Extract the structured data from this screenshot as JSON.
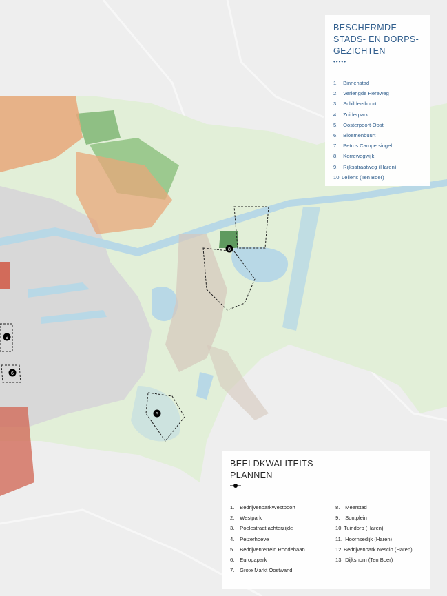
{
  "panels": {
    "stads": {
      "title_lines": [
        "BESCHERMDE",
        "STADS- EN DORPS-",
        "GEZICHTEN"
      ],
      "items": [
        {
          "num": "1.",
          "label": "Binnenstad"
        },
        {
          "num": "2.",
          "label": "Verlengde Hereweg"
        },
        {
          "num": "3.",
          "label": "Schildersbuurt"
        },
        {
          "num": "4.",
          "label": "Zuiderpark"
        },
        {
          "num": "5.",
          "label": "Oosterpoort-Oost"
        },
        {
          "num": "6.",
          "label": "Bloemenbuurt"
        },
        {
          "num": "7.",
          "label": "Petrus Campersingel"
        },
        {
          "num": "8.",
          "label": "Korrewegwijk"
        },
        {
          "num": "9.",
          "label": "Rijksstraatweg (Haren)"
        },
        {
          "num": "10.",
          "label": "Lellens (Ten Boer)"
        }
      ]
    },
    "plannen": {
      "title_lines": [
        "BEELDKWALITEITS-",
        "PLANNEN"
      ],
      "items_left": [
        {
          "num": "1.",
          "label": "BedrijvenparkWestpoort"
        },
        {
          "num": "2.",
          "label": "Westpark"
        },
        {
          "num": "3.",
          "label": "Poelestraat achterzijde"
        },
        {
          "num": "4.",
          "label": "Peizerhoeve"
        },
        {
          "num": "5.",
          "label": "Bedrijventerrein Roodehaan"
        },
        {
          "num": "6.",
          "label": "Europapark"
        },
        {
          "num": "7.",
          "label": "Grote Markt Oostwand"
        }
      ],
      "items_right": [
        {
          "num": "8.",
          "label": "Meerstad"
        },
        {
          "num": "9.",
          "label": "Sontplein"
        },
        {
          "num": "10.",
          "label": "Tuindorp (Haren)"
        },
        {
          "num": "11.",
          "label": "Hoornsedijk (Haren)"
        },
        {
          "num": "12.",
          "label": "Bedrijvenpark Nescio (Haren)"
        },
        {
          "num": "13.",
          "label": "Dijkshorn (Ten Boer)"
        }
      ]
    }
  },
  "map_labels": {
    "marker_8": "8",
    "marker_5": "5",
    "marker_9": "9",
    "marker_6": "6"
  },
  "colors": {
    "background": "#eeeeee",
    "protected_area": "#e2efd8",
    "green_area": "#8fbf84",
    "dark_green": "#5f9a5f",
    "water": "#b8d8e6",
    "housing_orange": "#e8a77a",
    "housing_red": "#d26b5a",
    "panel_blue_text": "#2b5a8a"
  }
}
